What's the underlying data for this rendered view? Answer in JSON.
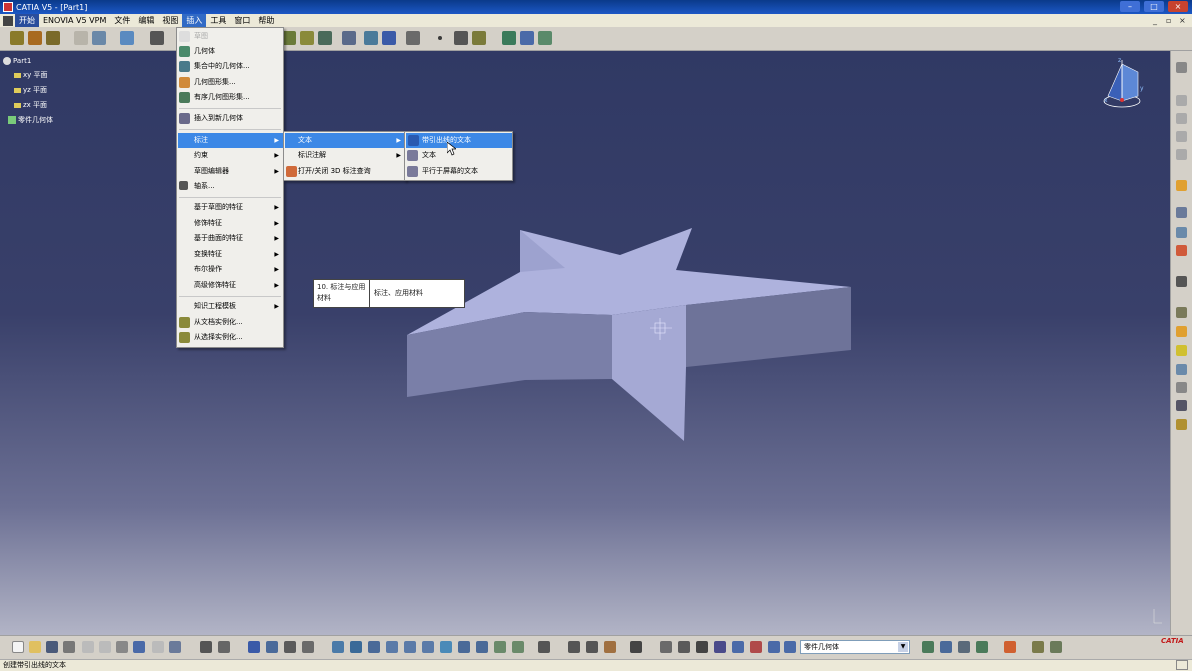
{
  "window": {
    "title": "CATIA V5 - [Part1]"
  },
  "menubar": {
    "items": [
      "开始",
      "ENOVIA V5 VPM",
      "文件",
      "编辑",
      "视图",
      "插入",
      "工具",
      "窗口",
      "帮助"
    ]
  },
  "tree": {
    "root": "Part1",
    "items": [
      "xy 平面",
      "yz 平面",
      "zx 平面",
      "零件几何体"
    ]
  },
  "insert_menu": {
    "items": [
      {
        "label": "草图",
        "disabled": true
      },
      {
        "label": "几何体"
      },
      {
        "label": "集合中的几何体..."
      },
      {
        "label": "几何图形集..."
      },
      {
        "label": "有序几何图形集..."
      },
      {
        "label": "插入到新几何体"
      },
      {
        "label": "标注",
        "highlighted": true
      },
      {
        "label": "约束"
      },
      {
        "label": "草图编辑器"
      },
      {
        "label": "轴系..."
      },
      {
        "label": "基于草图的特征"
      },
      {
        "label": "修饰特征"
      },
      {
        "label": "基于曲面的特征"
      },
      {
        "label": "变换特征"
      },
      {
        "label": "布尔操作"
      },
      {
        "label": "高级修饰特征"
      },
      {
        "label": "知识工程模板"
      },
      {
        "label": "从文档实例化..."
      },
      {
        "label": "从选择实例化..."
      }
    ]
  },
  "annotation_submenu": {
    "items": [
      "文本",
      "标识注解",
      "打开/关闭 3D 标注查询"
    ]
  },
  "text_submenu": {
    "items": [
      "带引出线的文本",
      "文本",
      "平行于屏幕的文本"
    ]
  },
  "tooltip": {
    "left": "10. 标注与应用材料",
    "right": "标注、应用材料"
  },
  "bottom_toolbar": {
    "body_selector": "零件几何体"
  },
  "statusbar": {
    "text": "创建带引出线的文本"
  },
  "compass": {
    "x": "x",
    "y": "y",
    "z": "z"
  },
  "logo": "CATIA",
  "colors": {
    "menu_highlight": "#3c88e6",
    "viewport_top": "#303964",
    "viewport_bottom": "#b2b4c6",
    "part_face": "#aeb2dd"
  }
}
